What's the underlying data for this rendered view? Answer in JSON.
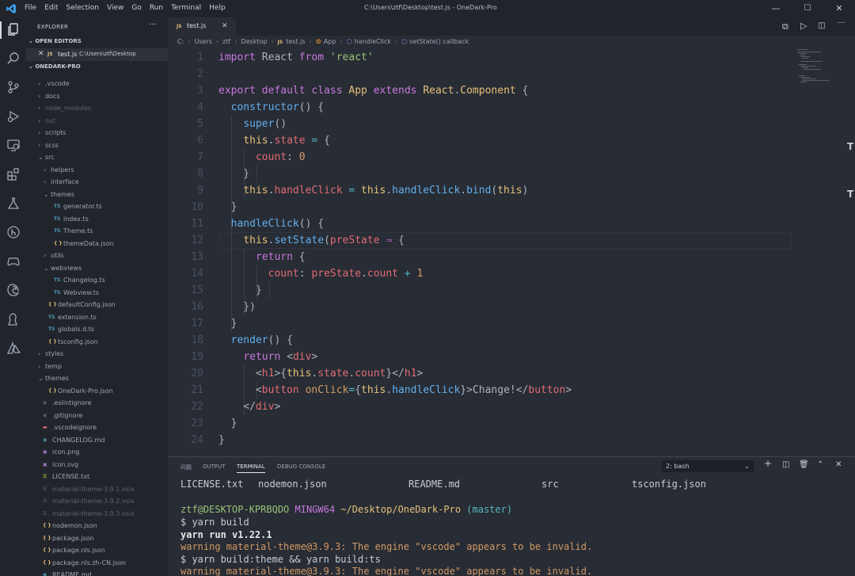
{
  "window": {
    "title": "C:\\Users\\ztf\\Desktop\\test.js - OneDark-Pro",
    "menu": [
      "File",
      "Edit",
      "Selection",
      "View",
      "Go",
      "Run",
      "Terminal",
      "Help"
    ],
    "controls": [
      "—",
      "☐",
      "✕"
    ]
  },
  "colors": {
    "accent": "#61afef",
    "keyword": "#c678dd",
    "string": "#98c379",
    "class": "#e5c07b",
    "function": "#61afef",
    "property": "#e06c75",
    "number": "#d19a66",
    "operator": "#56b6c2"
  },
  "activity_icons": [
    "files-icon",
    "search-icon",
    "source-control-icon",
    "run-debug-icon",
    "remote-explorer-icon",
    "extensions-icon",
    "testing-icon",
    "git-graph-icon",
    "game-controller-icon",
    "edge-icon",
    "live-share-icon",
    "azure-icon"
  ],
  "sidebar": {
    "header": "EXPLORER",
    "more": "···",
    "open_editors_title": "OPEN EDITORS",
    "open_editor": {
      "close": "✕",
      "badge": "JS",
      "name": "test.js",
      "path": "C:\\Users\\ztf\\Desktop"
    },
    "project_title": "ONEDARK-PRO",
    "tree": [
      {
        "label": ".vscode",
        "kind": "folder",
        "depth": 0,
        "open": false
      },
      {
        "label": "docs",
        "kind": "folder",
        "depth": 0,
        "open": false
      },
      {
        "label": "node_modules",
        "kind": "folder",
        "depth": 0,
        "open": false,
        "dim": true
      },
      {
        "label": "out",
        "kind": "folder",
        "depth": 0,
        "open": false,
        "dim": true
      },
      {
        "label": "scripts",
        "kind": "folder",
        "depth": 0,
        "open": false
      },
      {
        "label": "scss",
        "kind": "folder",
        "depth": 0,
        "open": false
      },
      {
        "label": "src",
        "kind": "folder",
        "depth": 0,
        "open": true
      },
      {
        "label": "helpers",
        "kind": "folder",
        "depth": 1,
        "open": false
      },
      {
        "label": "interface",
        "kind": "folder",
        "depth": 1,
        "open": false
      },
      {
        "label": "themes",
        "kind": "folder",
        "depth": 1,
        "open": true
      },
      {
        "label": "generator.ts",
        "kind": "ts",
        "depth": 2
      },
      {
        "label": "index.ts",
        "kind": "ts",
        "depth": 2
      },
      {
        "label": "Theme.ts",
        "kind": "ts",
        "depth": 2
      },
      {
        "label": "themeData.json",
        "kind": "json",
        "depth": 2
      },
      {
        "label": "utils",
        "kind": "folder",
        "depth": 1,
        "open": false
      },
      {
        "label": "webviews",
        "kind": "folder",
        "depth": 1,
        "open": true
      },
      {
        "label": "Changelog.ts",
        "kind": "ts",
        "depth": 2
      },
      {
        "label": "Webview.ts",
        "kind": "ts",
        "depth": 2
      },
      {
        "label": "defaultConfig.json",
        "kind": "json",
        "depth": 1
      },
      {
        "label": "extension.ts",
        "kind": "ts",
        "depth": 1
      },
      {
        "label": "globals.d.ts",
        "kind": "ts",
        "depth": 1
      },
      {
        "label": "tsconfig.json",
        "kind": "json",
        "depth": 1
      },
      {
        "label": "styles",
        "kind": "folder",
        "depth": 0,
        "open": false
      },
      {
        "label": "temp",
        "kind": "folder",
        "depth": 0,
        "open": false
      },
      {
        "label": "themes",
        "kind": "folder",
        "depth": 0,
        "open": true
      },
      {
        "label": "OneDark-Pro.json",
        "kind": "json",
        "depth": 1
      },
      {
        "label": ".eslintignore",
        "kind": "ignore",
        "depth": 0
      },
      {
        "label": ".gitignore",
        "kind": "ignore",
        "depth": 0
      },
      {
        "label": ".vscodeignore",
        "kind": "vscode",
        "depth": 0
      },
      {
        "label": "CHANGELOG.md",
        "kind": "md",
        "depth": 0
      },
      {
        "label": "icon.png",
        "kind": "img",
        "depth": 0
      },
      {
        "label": "icon.svg",
        "kind": "svg",
        "depth": 0
      },
      {
        "label": "LICENSE.txt",
        "kind": "txt",
        "depth": 0
      },
      {
        "label": "material-theme-3.9.1.vsix",
        "kind": "vsix",
        "depth": 0,
        "dim": true
      },
      {
        "label": "material-theme-3.9.2.vsix",
        "kind": "vsix",
        "depth": 0,
        "dim": true
      },
      {
        "label": "material-theme-3.9.3.vsix",
        "kind": "vsix",
        "depth": 0,
        "dim": true
      },
      {
        "label": "nodemon.json",
        "kind": "json",
        "depth": 0
      },
      {
        "label": "package.json",
        "kind": "json",
        "depth": 0
      },
      {
        "label": "package.nls.json",
        "kind": "json",
        "depth": 0
      },
      {
        "label": "package.nls.zh-CN.json",
        "kind": "json",
        "depth": 0
      },
      {
        "label": "README.md",
        "kind": "md",
        "depth": 0
      }
    ]
  },
  "editor": {
    "tab": {
      "badge": "JS",
      "name": "test.js",
      "close": "✕"
    },
    "breadcrumb": [
      "C:",
      "Users",
      "ztf",
      "Desktop",
      "test.js",
      "App",
      "handleClick",
      "setState() callback"
    ],
    "code": [
      [
        [
          "k",
          "import"
        ],
        [
          "d",
          " React "
        ],
        [
          "k",
          "from"
        ],
        [
          "d",
          " "
        ],
        [
          "s",
          "'react'"
        ]
      ],
      [],
      [
        [
          "k",
          "export default class"
        ],
        [
          "d",
          " "
        ],
        [
          "c",
          "App"
        ],
        [
          "d",
          " "
        ],
        [
          "k",
          "extends"
        ],
        [
          "d",
          " "
        ],
        [
          "c",
          "React"
        ],
        [
          "d",
          "."
        ],
        [
          "c",
          "Component"
        ],
        [
          "d",
          " {"
        ]
      ],
      [
        [
          "d",
          "  "
        ],
        [
          "f",
          "constructor"
        ],
        [
          "d",
          "() {"
        ]
      ],
      [
        [
          "d",
          "    "
        ],
        [
          "f",
          "super"
        ],
        [
          "d",
          "()"
        ]
      ],
      [
        [
          "d",
          "    "
        ],
        [
          "c",
          "this"
        ],
        [
          "d",
          "."
        ],
        [
          "p",
          "state"
        ],
        [
          "d",
          " "
        ],
        [
          "o",
          "="
        ],
        [
          "d",
          " {"
        ]
      ],
      [
        [
          "d",
          "      "
        ],
        [
          "p",
          "count"
        ],
        [
          "d",
          ": "
        ],
        [
          "n",
          "0"
        ]
      ],
      [
        [
          "d",
          "    }"
        ]
      ],
      [
        [
          "d",
          "    "
        ],
        [
          "c",
          "this"
        ],
        [
          "d",
          "."
        ],
        [
          "p",
          "handleClick"
        ],
        [
          "d",
          " "
        ],
        [
          "o",
          "="
        ],
        [
          "d",
          " "
        ],
        [
          "c",
          "this"
        ],
        [
          "d",
          "."
        ],
        [
          "f",
          "handleClick"
        ],
        [
          "d",
          "."
        ],
        [
          "f",
          "bind"
        ],
        [
          "d",
          "("
        ],
        [
          "c",
          "this"
        ],
        [
          "d",
          ")"
        ]
      ],
      [
        [
          "d",
          "  }"
        ]
      ],
      [
        [
          "d",
          "  "
        ],
        [
          "f",
          "handleClick"
        ],
        [
          "d",
          "() {"
        ]
      ],
      [
        [
          "d",
          "    "
        ],
        [
          "c",
          "this"
        ],
        [
          "d",
          "."
        ],
        [
          "f",
          "setState"
        ],
        [
          "d",
          "("
        ],
        [
          "p",
          "preState"
        ],
        [
          "d",
          " "
        ],
        [
          "k",
          "⇒"
        ],
        [
          "d",
          " {"
        ]
      ],
      [
        [
          "d",
          "      "
        ],
        [
          "k",
          "return"
        ],
        [
          "d",
          " {"
        ]
      ],
      [
        [
          "d",
          "        "
        ],
        [
          "p",
          "count"
        ],
        [
          "d",
          ": "
        ],
        [
          "p",
          "preState"
        ],
        [
          "d",
          "."
        ],
        [
          "p",
          "count"
        ],
        [
          "d",
          " "
        ],
        [
          "o",
          "+"
        ],
        [
          "d",
          " "
        ],
        [
          "n",
          "1"
        ]
      ],
      [
        [
          "d",
          "      }"
        ]
      ],
      [
        [
          "d",
          "    })"
        ]
      ],
      [
        [
          "d",
          "  }"
        ]
      ],
      [
        [
          "d",
          "  "
        ],
        [
          "f",
          "render"
        ],
        [
          "d",
          "() {"
        ]
      ],
      [
        [
          "d",
          "    "
        ],
        [
          "k",
          "return"
        ],
        [
          "d",
          " <"
        ],
        [
          "p",
          "div"
        ],
        [
          "d",
          ">"
        ]
      ],
      [
        [
          "d",
          "      <"
        ],
        [
          "p",
          "h1"
        ],
        [
          "d",
          ">{"
        ],
        [
          "c",
          "this"
        ],
        [
          "d",
          "."
        ],
        [
          "p",
          "state"
        ],
        [
          "d",
          "."
        ],
        [
          "p",
          "count"
        ],
        [
          "d",
          "}</"
        ],
        [
          "p",
          "h1"
        ],
        [
          "d",
          ">"
        ]
      ],
      [
        [
          "d",
          "      <"
        ],
        [
          "p",
          "button"
        ],
        [
          "d",
          " "
        ],
        [
          "n",
          "onClick"
        ],
        [
          "o",
          "="
        ],
        [
          "d",
          "{"
        ],
        [
          "c",
          "this"
        ],
        [
          "d",
          "."
        ],
        [
          "f",
          "handleClick"
        ],
        [
          "d",
          "}>Change!</"
        ],
        [
          "p",
          "button"
        ],
        [
          "d",
          ">"
        ]
      ],
      [
        [
          "d",
          "    </"
        ],
        [
          "p",
          "div"
        ],
        [
          "d",
          ">"
        ]
      ],
      [
        [
          "d",
          "  }"
        ]
      ],
      [
        [
          "d",
          "}"
        ]
      ]
    ]
  },
  "panel": {
    "tabs": [
      "问题",
      "OUTPUT",
      "TERMINAL",
      "DEBUG CONSOLE"
    ],
    "active_tab": "TERMINAL",
    "terminal_select": "2: bash",
    "actions": [
      "+",
      "‖",
      "🗑",
      "⌃",
      "✕"
    ],
    "terminal": {
      "ls": [
        "LICENSE.txt",
        "nodemon.json",
        "README.md",
        "src",
        "tsconfig.json"
      ],
      "prompt_user": "ztf@DESKTOP-KPRBQDO",
      "prompt_env": "MINGW64",
      "prompt_path": "~/Desktop/OneDark-Pro",
      "prompt_branch": "(master)",
      "lines": [
        {
          "t": "$ yarn build",
          "c": "plain"
        },
        {
          "t": "yarn run v1.22.1",
          "c": "bold"
        },
        {
          "t": "warning material-theme@3.9.3: The engine \"vscode\" appears to be invalid.",
          "c": "warn",
          "w": "warning",
          "r": " material-theme@3.9.3: The engine \"vscode\" appears to be invalid."
        },
        {
          "t": "$ yarn build:theme && yarn build:ts",
          "c": "plain"
        },
        {
          "t": "warning material-theme@3.9.3: The engine \"vscode\" appears to be invalid.",
          "c": "warn",
          "w": "warning",
          "r": " material-theme@3.9.3: The engine \"vscode\" appears to be invalid."
        }
      ]
    }
  }
}
